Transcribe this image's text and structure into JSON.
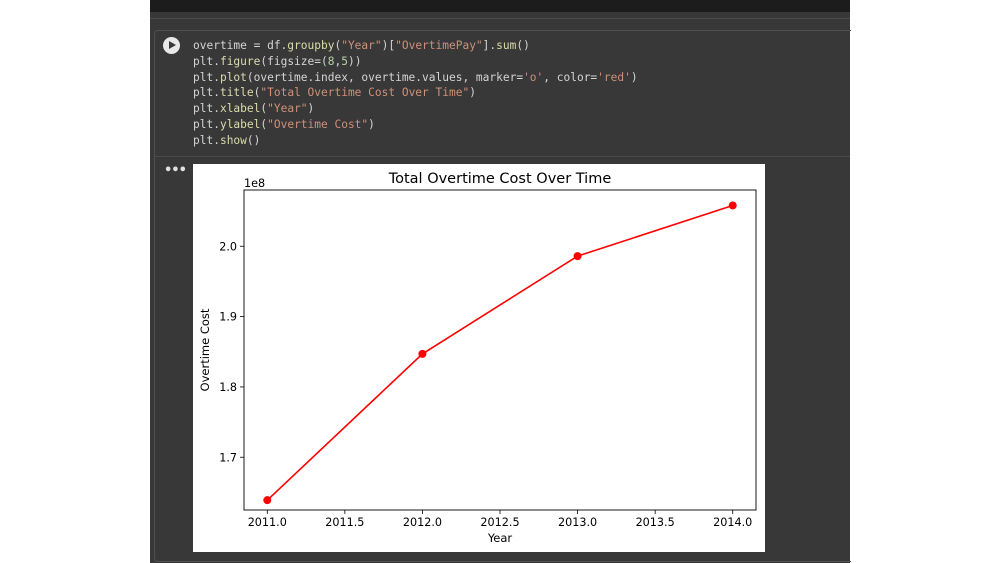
{
  "code_lines": [
    [
      [
        "overtime = df.",
        ""
      ],
      [
        "groupby",
        "fn"
      ],
      [
        "(",
        ""
      ],
      [
        "\"Year\"",
        "str"
      ],
      [
        ")[",
        ""
      ],
      [
        "\"OvertimePay\"",
        "str"
      ],
      [
        "].",
        ""
      ],
      [
        "sum",
        "fn"
      ],
      [
        "()",
        ""
      ]
    ],
    [
      [
        "plt.",
        ""
      ],
      [
        "figure",
        "fn"
      ],
      [
        "(figsize=(",
        ""
      ],
      [
        "8",
        "num"
      ],
      [
        ",",
        ""
      ],
      [
        "5",
        "num"
      ],
      [
        "))",
        ""
      ]
    ],
    [
      [
        "plt.",
        ""
      ],
      [
        "plot",
        "fn"
      ],
      [
        "(overtime.index, overtime.values, marker=",
        ""
      ],
      [
        "'o'",
        "str"
      ],
      [
        ", color=",
        ""
      ],
      [
        "'red'",
        "str"
      ],
      [
        ")",
        ""
      ]
    ],
    [
      [
        "plt.",
        ""
      ],
      [
        "title",
        "fn"
      ],
      [
        "(",
        ""
      ],
      [
        "\"Total Overtime Cost Over Time\"",
        "str"
      ],
      [
        ")",
        ""
      ]
    ],
    [
      [
        "plt.",
        ""
      ],
      [
        "xlabel",
        "fn"
      ],
      [
        "(",
        ""
      ],
      [
        "\"Year\"",
        "str"
      ],
      [
        ")",
        ""
      ]
    ],
    [
      [
        "plt.",
        ""
      ],
      [
        "ylabel",
        "fn"
      ],
      [
        "(",
        ""
      ],
      [
        "\"Overtime Cost\"",
        "str"
      ],
      [
        ")",
        ""
      ]
    ],
    [
      [
        "plt.",
        ""
      ],
      [
        "show",
        "fn"
      ],
      [
        "()",
        ""
      ]
    ]
  ],
  "output_menu_label": "•••",
  "chart_data": {
    "type": "line",
    "title": "Total Overtime Cost Over Time",
    "xlabel": "Year",
    "ylabel": "Overtime Cost",
    "offset_label": "1e8",
    "x": [
      2011,
      2012,
      2013,
      2014
    ],
    "y": [
      1.639,
      1.847,
      1.986,
      2.058
    ],
    "xlim": [
      2010.85,
      2014.15
    ],
    "ylim": [
      1.625,
      2.08
    ],
    "xticks": [
      2011.0,
      2011.5,
      2012.0,
      2012.5,
      2013.0,
      2013.5,
      2014.0
    ],
    "xtick_labels": [
      "2011.0",
      "2011.5",
      "2012.0",
      "2012.5",
      "2013.0",
      "2013.5",
      "2014.0"
    ],
    "yticks": [
      1.7,
      1.8,
      1.9,
      2.0
    ],
    "ytick_labels": [
      "1.7",
      "1.8",
      "1.9",
      "2.0"
    ],
    "color": "#ff0000",
    "marker": "o",
    "grid": false
  }
}
